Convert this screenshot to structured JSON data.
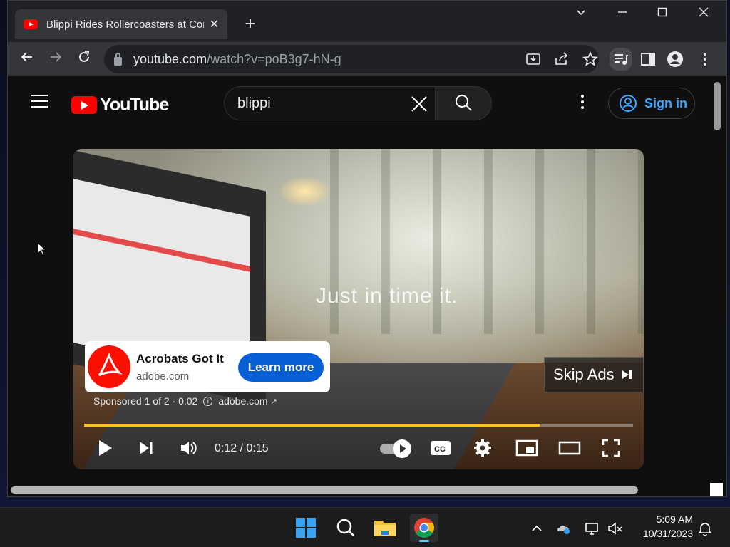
{
  "browser": {
    "tab_title": "Blippi Rides Rollercoasters at Cor",
    "url_host": "youtube.com",
    "url_path": "/watch?v=poB3g7-hN-g"
  },
  "youtube": {
    "logo_text": "YouTube",
    "search_value": "blippi",
    "sign_in_label": "Sign in"
  },
  "player": {
    "video_caption": "Just in time it.",
    "ad_title": "Acrobats Got It",
    "ad_domain": "adobe.com",
    "ad_cta": "Learn more",
    "sponsored_text": "Sponsored 1 of 2 · 0:02",
    "sponsored_link": "adobe.com",
    "skip_label": "Skip Ads",
    "time_display": "0:12 / 0:15",
    "progress_fraction": 0.83,
    "progress_color": "#fbc02d"
  },
  "taskbar": {
    "time": "5:09 AM",
    "date": "10/31/2023"
  },
  "colors": {
    "accent_blue": "#065fd4",
    "youtube_red": "#ff0000",
    "adobe_red": "#fa0f00",
    "sign_in_blue": "#3ea6ff"
  },
  "icons": {
    "back": "arrow-left-icon",
    "forward": "arrow-right-icon",
    "reload": "reload-icon",
    "install": "install-app-icon",
    "share": "share-icon",
    "bookmark": "star-icon",
    "media": "media-control-icon",
    "side_panel": "side-panel-icon",
    "profile": "profile-icon",
    "menu": "kebab-menu-icon"
  }
}
